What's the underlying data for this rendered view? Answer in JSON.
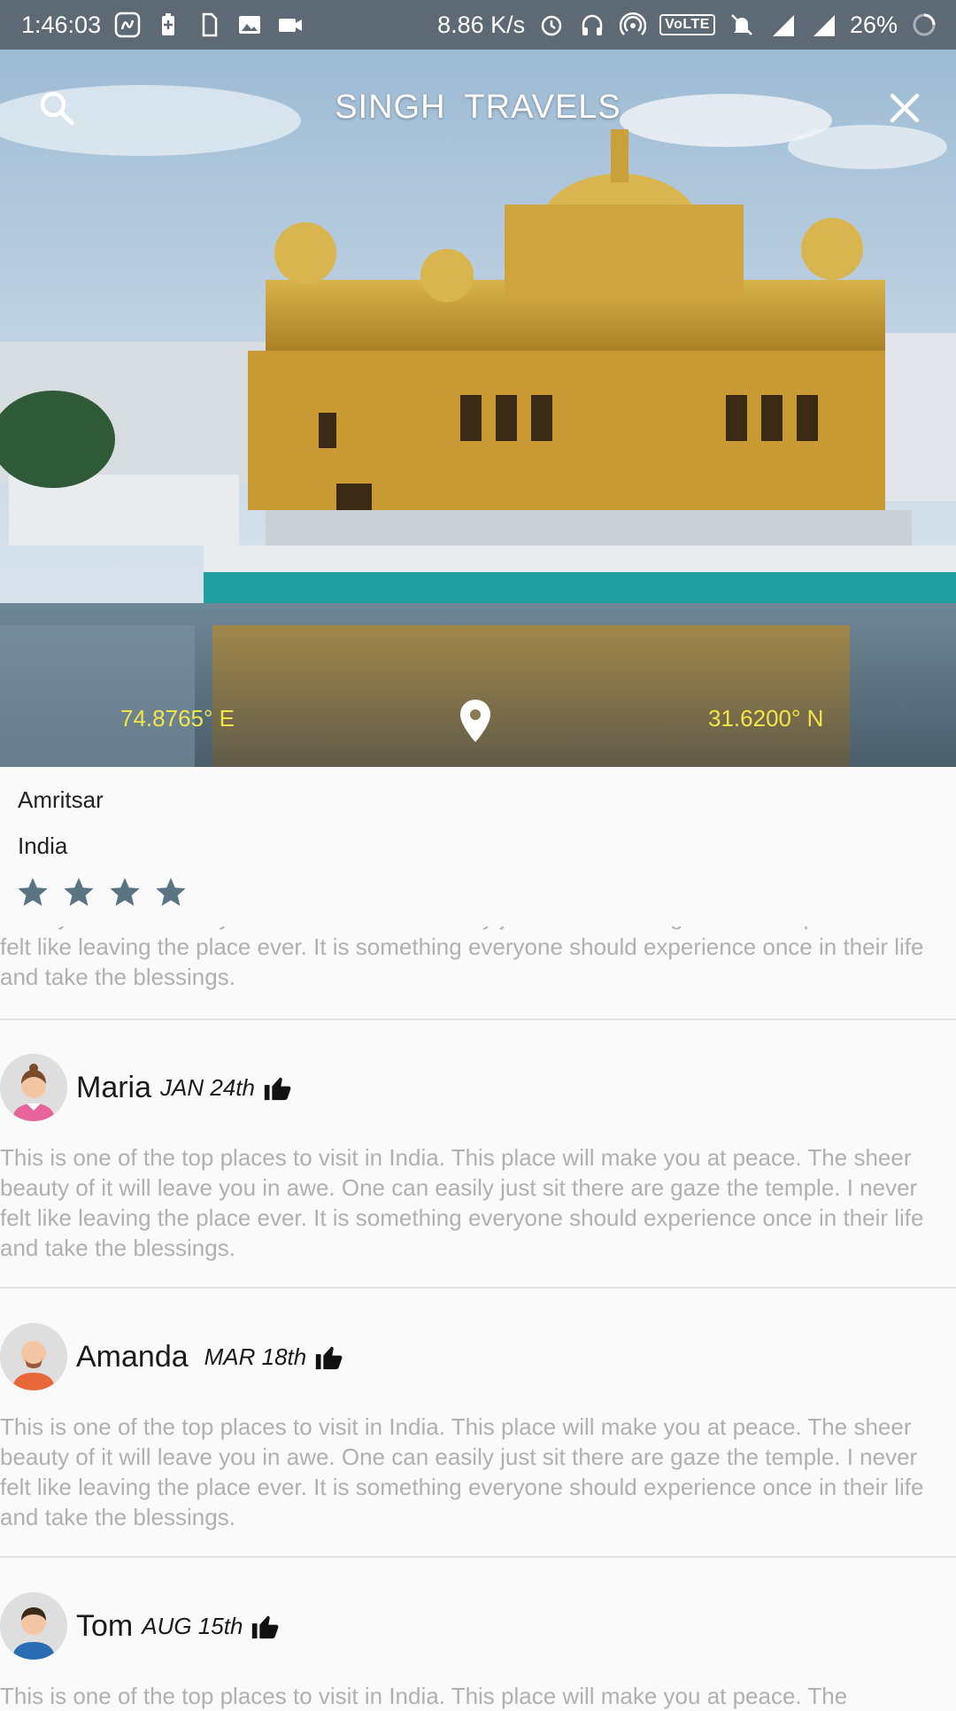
{
  "status_bar": {
    "time": "1:46:03",
    "speed": "8.86 K/s",
    "network_badge": "VoLTE",
    "network_type": "4G",
    "battery": "26%",
    "icons": [
      "saavn-icon",
      "battery-saver-icon",
      "sim-icon",
      "gallery-icon",
      "video-icon",
      "alarm-icon",
      "headphones-icon",
      "hotspot-icon",
      "mute-icon",
      "signal-icon",
      "signal-roaming-icon",
      "loading-icon"
    ]
  },
  "app_bar": {
    "title": "SINGH  TRAVELS",
    "search_icon": "search-icon",
    "close_icon": "close-icon"
  },
  "location": {
    "longitude": "74.8765° E",
    "latitude": "31.6200° N",
    "name": "Amritsar",
    "country": "India",
    "rating": 4,
    "rating_max": 4
  },
  "summary_text": "This is one of the top places to visit in India. This place will make you at peace. The sheer beauty of it will leave you in awe. One can easily just sit there are gaze the temple. I never felt like leaving the place ever. It is something everyone should experience once in their life and take the blessings.",
  "reviews": [
    {
      "name": "Maria",
      "date": "JAN 24th",
      "text": "This is one of the top places to visit in India. This place will make you at peace. The sheer beauty of it will leave you in awe. One can easily just sit there are gaze the temple. I never felt like leaving the place ever. It is something everyone should experience once in their life and take the blessings."
    },
    {
      "name": "Amanda",
      "date": "MAR 18th",
      "text": "This is one of the top places to visit in India. This place will make you at peace. The sheer beauty of it will leave you in awe. One can easily just sit there are gaze the temple. I never felt like leaving the place ever. It is something everyone should experience once in their life and take the blessings."
    },
    {
      "name": "Tom",
      "date": "AUG 15th",
      "text": "This is one of the top places to visit in India. This place will make you at peace. The"
    }
  ],
  "colors": {
    "status_bar": "#5d6a76",
    "coord_text": "#f2e54a",
    "star": "#5a7482",
    "review_text": "#b0b0b0"
  }
}
